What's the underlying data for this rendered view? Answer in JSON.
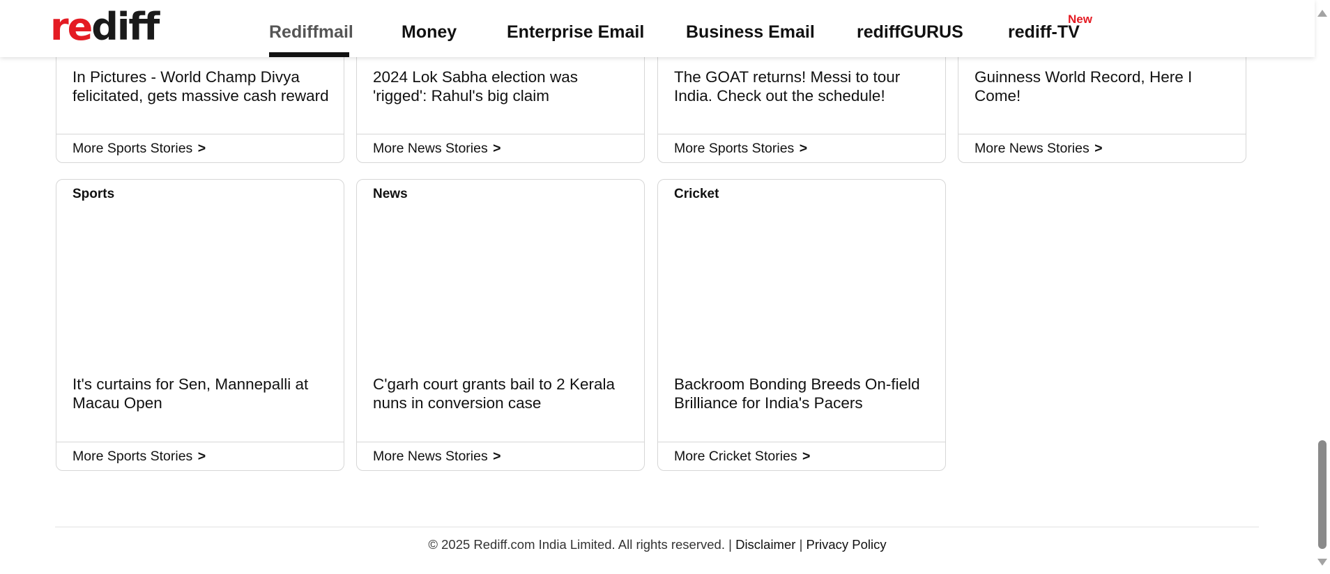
{
  "logo": {
    "part1": "re",
    "part2": "diff"
  },
  "nav": {
    "items": [
      {
        "label": "Rediffmail"
      },
      {
        "label": "Money"
      },
      {
        "label": "Enterprise Email"
      },
      {
        "label": "Business Email"
      },
      {
        "label": "rediffGURUS"
      },
      {
        "label": "rediff-TV"
      }
    ],
    "new_badge": "New"
  },
  "top_cards": [
    {
      "headline": "In Pictures - World Champ Divya felicitated, gets massive cash reward",
      "more": "More Sports Stories"
    },
    {
      "headline": "2024 Lok Sabha election was 'rigged': Rahul's big claim",
      "more": "More News Stories"
    },
    {
      "headline": "The GOAT returns! Messi to tour India. Check out the schedule!",
      "more": "More Sports Stories"
    },
    {
      "headline": "Guinness World Record, Here I Come!",
      "more": "More News Stories"
    }
  ],
  "bottom_cards": [
    {
      "category": "Sports",
      "headline": "It's curtains for Sen, Mannepalli at Macau Open",
      "more": "More Sports Stories"
    },
    {
      "category": "News",
      "headline": "C'garh court grants bail to 2 Kerala nuns in conversion case",
      "more": "More News Stories"
    },
    {
      "category": "Cricket",
      "headline": "Backroom Bonding Breeds On-field Brilliance for India's Pacers",
      "more": "More Cricket Stories"
    }
  ],
  "more_arrow": ">",
  "footer": {
    "copyright": "© 2025 Rediff.com India Limited. All rights reserved. |",
    "disclaimer": "Disclaimer",
    "separator": "|",
    "privacy": "Privacy Policy"
  },
  "colors": {
    "brand_red": "#e41b23",
    "text": "#111111",
    "border": "#d6d6d6"
  }
}
